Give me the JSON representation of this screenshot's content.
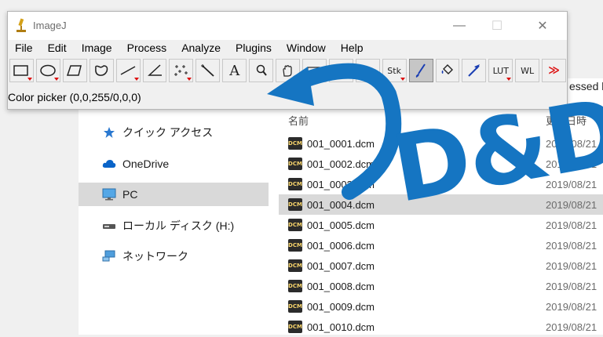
{
  "imagej": {
    "title": "ImageJ",
    "menu": [
      "File",
      "Edit",
      "Image",
      "Process",
      "Analyze",
      "Plugins",
      "Window",
      "Help"
    ],
    "window_controls": {
      "minimize": "—",
      "maximize": "☐",
      "close": "✕"
    },
    "tools": [
      {
        "name": "rectangle-tool",
        "label": ""
      },
      {
        "name": "oval-tool",
        "label": ""
      },
      {
        "name": "polygon-tool",
        "label": ""
      },
      {
        "name": "freehand-tool",
        "label": ""
      },
      {
        "name": "line-tool",
        "label": ""
      },
      {
        "name": "angle-tool",
        "label": ""
      },
      {
        "name": "multipoint-tool",
        "label": ""
      },
      {
        "name": "wand-tool",
        "label": ""
      },
      {
        "name": "text-tool",
        "label": "A"
      },
      {
        "name": "zoom-tool",
        "label": ""
      },
      {
        "name": "hand-tool",
        "label": ""
      },
      {
        "name": "dropper-tool",
        "label": ""
      },
      {
        "name": "spare-tool",
        "label": ""
      },
      {
        "name": "spare-tool-2",
        "label": ""
      },
      {
        "name": "stack-tool",
        "label": "Stk"
      },
      {
        "name": "brush-tool",
        "label": ""
      },
      {
        "name": "flood-fill-tool",
        "label": ""
      },
      {
        "name": "arrow-tool",
        "label": ""
      },
      {
        "name": "lut-tool",
        "label": "LUT"
      },
      {
        "name": "window-level-tool",
        "label": "WL"
      },
      {
        "name": "more-tools",
        "label": "≫"
      }
    ],
    "status": "Color picker (0,0,255/0,0,0)"
  },
  "explorer": {
    "search_fragment": "essed by",
    "nav": [
      {
        "label": "クイック アクセス",
        "icon": "star-icon"
      },
      {
        "label": "OneDrive",
        "icon": "cloud-icon"
      },
      {
        "label": "PC",
        "icon": "monitor-icon",
        "selected": true
      },
      {
        "label": "ローカル ディスク (H:)",
        "icon": "drive-icon"
      },
      {
        "label": "ネットワーク",
        "icon": "network-icon"
      }
    ],
    "columns": {
      "name": "名前",
      "date": "更新日時"
    },
    "files": [
      {
        "name": "001_0001.dcm",
        "date": "2019/08/21"
      },
      {
        "name": "001_0002.dcm",
        "date": "2019/08/21"
      },
      {
        "name": "001_0003.dcm",
        "date": "2019/08/21"
      },
      {
        "name": "001_0004.dcm",
        "date": "2019/08/21",
        "selected": true
      },
      {
        "name": "001_0005.dcm",
        "date": "2019/08/21"
      },
      {
        "name": "001_0006.dcm",
        "date": "2019/08/21"
      },
      {
        "name": "001_0007.dcm",
        "date": "2019/08/21"
      },
      {
        "name": "001_0008.dcm",
        "date": "2019/08/21"
      },
      {
        "name": "001_0009.dcm",
        "date": "2019/08/21"
      },
      {
        "name": "001_0010.dcm",
        "date": "2019/08/21"
      }
    ],
    "file_icon_text": "DCM"
  },
  "overlay": {
    "text": "D&D",
    "color": "#1575c2"
  }
}
